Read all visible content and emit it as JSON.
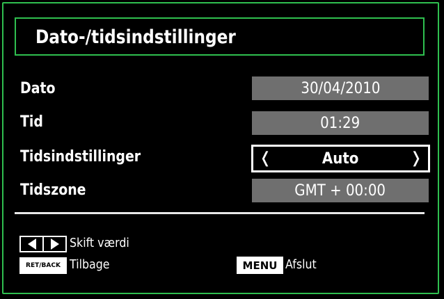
{
  "header": {
    "title": "Dato-/tidsindstillinger"
  },
  "settings": [
    {
      "label": "Dato",
      "value": "30/04/2010"
    },
    {
      "label": "Tid",
      "value": "01:29"
    },
    {
      "label": "Tidsindstillinger",
      "value": "Auto"
    },
    {
      "label": "Tidszone",
      "value": "GMT + 00:00"
    }
  ],
  "footer": {
    "lr_hint": "Skift værdi",
    "back_key": "RET/BACK",
    "back_hint": "Tilbage",
    "menu_key": "MENU",
    "menu_hint": "Afslut"
  },
  "icons": {
    "left": "chevron-left-icon",
    "right": "chevron-right-icon"
  },
  "colors": {
    "frame": "#2fbf4f",
    "value_bg": "#6f6f6f",
    "background": "#000000"
  }
}
